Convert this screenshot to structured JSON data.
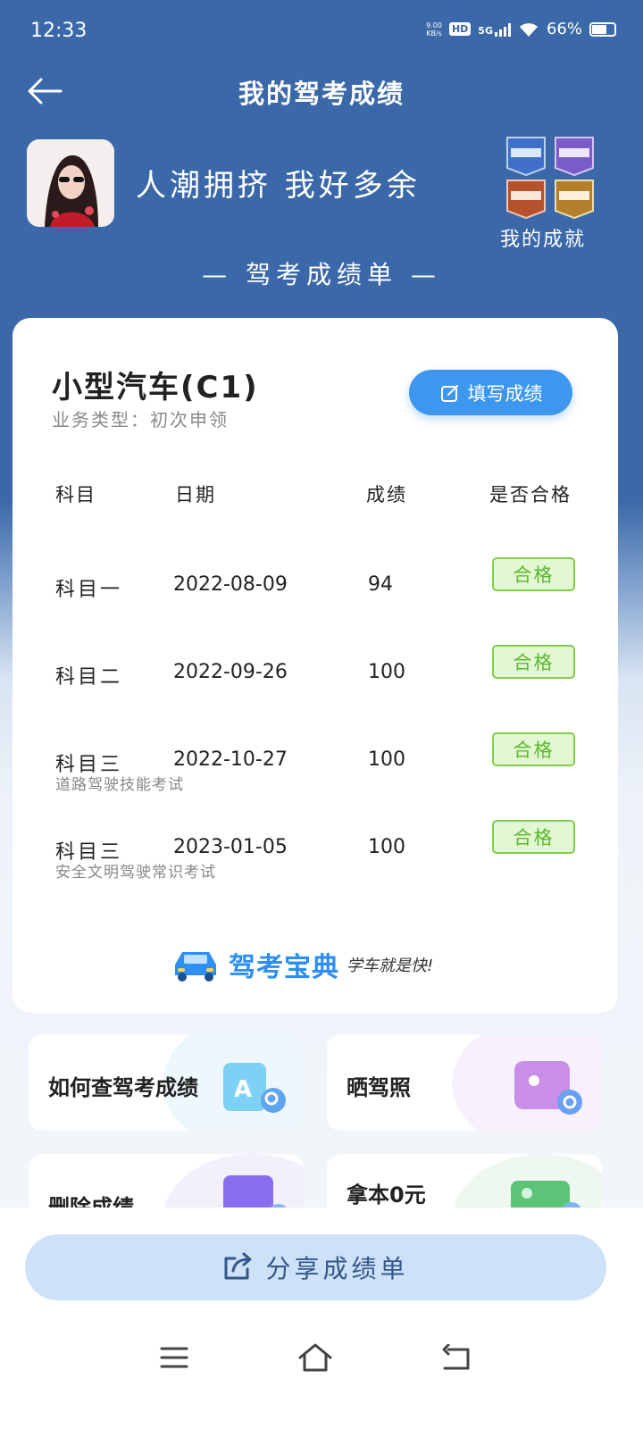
{
  "status_bar": {
    "time": "12:33",
    "net_speed_value": "9.00",
    "net_speed_unit": "KB/s",
    "hd": "HD",
    "network": "5G",
    "battery": "66%"
  },
  "header": {
    "title": "我的驾考成绩",
    "nickname": "人潮拥挤 我好多余",
    "achievements_label": "我的成就",
    "subtitle": "— 驾考成绩单 —"
  },
  "card": {
    "license_type": "小型汽车(C1)",
    "business_type": "业务类型：初次申领",
    "fill_button": "填写成绩",
    "columns": [
      "科目",
      "日期",
      "成绩",
      "是否合格"
    ],
    "rows": [
      {
        "subject": "科目一",
        "note": "",
        "date": "2022-08-09",
        "score": "94",
        "result": "合格"
      },
      {
        "subject": "科目二",
        "note": "",
        "date": "2022-09-26",
        "score": "100",
        "result": "合格"
      },
      {
        "subject": "科目三",
        "note": "道路驾驶技能考试",
        "date": "2022-10-27",
        "score": "100",
        "result": "合格"
      },
      {
        "subject": "科目三",
        "note": "安全文明驾驶常识考试",
        "date": "2023-01-05",
        "score": "100",
        "result": "合格"
      }
    ],
    "brand": "驾考宝典",
    "slogan": "学车就是快!"
  },
  "tiles": [
    {
      "label": "如何查驾考成绩"
    },
    {
      "label": "晒驾照"
    },
    {
      "label": "删除成绩"
    },
    {
      "label": "拿本0元"
    }
  ],
  "share_button": "分享成绩单",
  "colors": {
    "header_bg": "#3a68a8",
    "accent": "#3e97ee",
    "pass_green": "#5cb82e",
    "share_bg": "#cde2f8"
  }
}
